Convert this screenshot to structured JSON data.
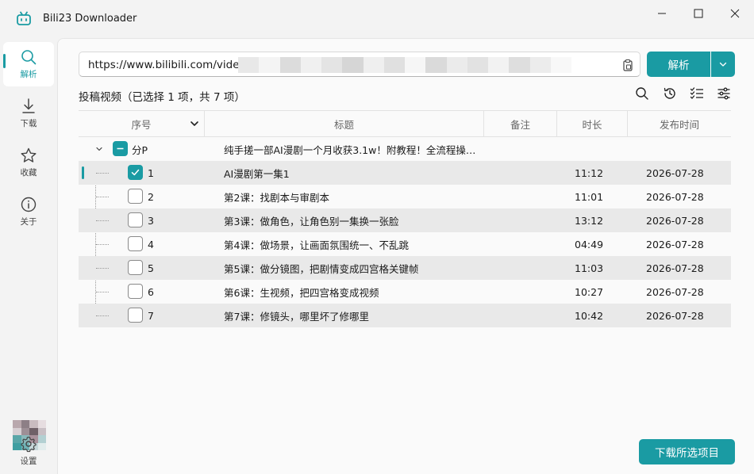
{
  "window": {
    "title": "Bili23 Downloader"
  },
  "sidebar": {
    "items": [
      {
        "id": "parse",
        "label": "解析",
        "icon": "search-icon",
        "active": true
      },
      {
        "id": "download",
        "label": "下载",
        "icon": "download-icon",
        "active": false
      },
      {
        "id": "favorites",
        "label": "收藏",
        "icon": "star-icon",
        "active": false
      },
      {
        "id": "about",
        "label": "关于",
        "icon": "info-icon",
        "active": false
      }
    ],
    "settings_label": "设置"
  },
  "search": {
    "url": "https://www.bilibili.com/video/"
  },
  "parse_button": {
    "label": "解析"
  },
  "section": {
    "title": "投稿视频（已选择 1 项，共 7 项）"
  },
  "toolbar_icons": [
    "search-icon",
    "history-icon",
    "checklist-icon",
    "filter-settings-icon"
  ],
  "table": {
    "columns": [
      "序号",
      "标题",
      "备注",
      "时长",
      "发布时间"
    ],
    "group": {
      "label": "分P",
      "title": "纯手搓一部AI漫剧一个月收获3.1w！附教程！全流程操…",
      "state": "partial"
    },
    "rows": [
      {
        "index": "1",
        "title": "AI漫剧第一集1",
        "duration": "11:12",
        "date": "2026-07-28",
        "checked": true
      },
      {
        "index": "2",
        "title": "第2课：找剧本与审剧本",
        "duration": "11:01",
        "date": "2026-07-28",
        "checked": false
      },
      {
        "index": "3",
        "title": "第3课：做角色，让角色别一集换一张脸",
        "duration": "13:12",
        "date": "2026-07-28",
        "checked": false
      },
      {
        "index": "4",
        "title": "第4课：做场景，让画面氛围统一、不乱跳",
        "duration": "04:49",
        "date": "2026-07-28",
        "checked": false
      },
      {
        "index": "5",
        "title": "第5课：做分镜图，把剧情变成四宫格关键帧",
        "duration": "11:03",
        "date": "2026-07-28",
        "checked": false
      },
      {
        "index": "6",
        "title": "第6课：生视频，把四宫格变成视频",
        "duration": "10:27",
        "date": "2026-07-28",
        "checked": false
      },
      {
        "index": "7",
        "title": "第7课：修镜头，哪里坏了修哪里",
        "duration": "10:42",
        "date": "2026-07-28",
        "checked": false
      }
    ]
  },
  "download_button": {
    "label": "下载所选项目"
  },
  "colors": {
    "accent": "#1a9ba3",
    "row_shade": "#e9e9e9"
  }
}
